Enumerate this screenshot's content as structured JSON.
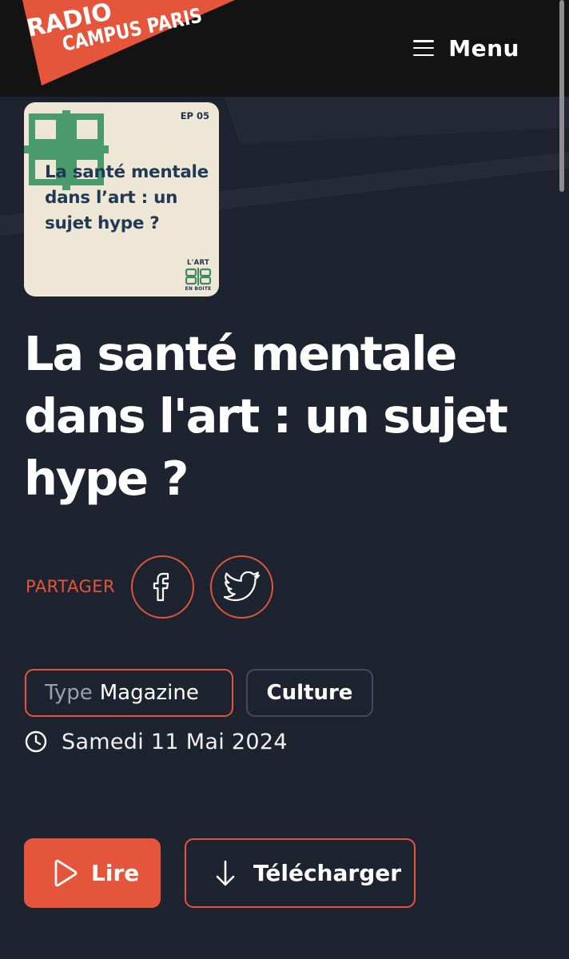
{
  "header": {
    "logo_line1": "RADIO",
    "logo_line2": "CAMPUS PARIS",
    "menu_label": "Menu",
    "icon": "hamburger-icon"
  },
  "cover": {
    "episode": "EP 05",
    "title": "La santé mentale dans l’art : un sujet hype ?",
    "brand_top": "L'ART",
    "brand_bottom": "EN BOITE"
  },
  "article": {
    "title": "La santé mentale dans l'art : un sujet hype ?"
  },
  "share": {
    "label": "PARTAGER",
    "buttons": [
      {
        "icon": "facebook-icon"
      },
      {
        "icon": "twitter-icon"
      }
    ]
  },
  "tags": {
    "type_key": "Type",
    "type_value": "Magazine",
    "category": "Culture"
  },
  "date": {
    "icon": "clock-icon",
    "text": "Samedi 11 Mai 2024"
  },
  "actions": {
    "play_label": "Lire",
    "download_label": "Télécharger"
  },
  "colors": {
    "background": "#1e2330",
    "header": "#131313",
    "accent": "#e4553b",
    "cover_bg": "#efe7d6",
    "cover_text": "#1f3a56"
  }
}
